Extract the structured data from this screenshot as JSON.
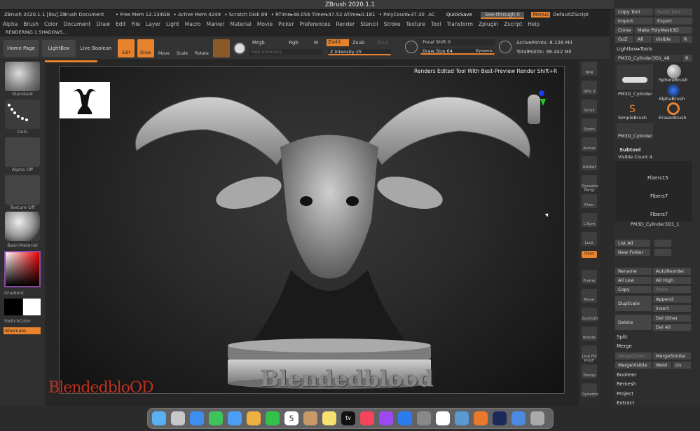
{
  "window": {
    "title": "ZBrush 2020.1.1"
  },
  "infobar": {
    "doc": "ZBrush 2020.1.1 [ibu] ZBrush Document",
    "free_mem": "• Free Mem 12.134GB",
    "active_mem": "• Active Mem 4249",
    "scratch": "• Scratch Disk 89",
    "rtime": "• RTime▸48.056 Timer▸47.52 ATime▸0.181",
    "polycount": "• PolyCount▸37.30",
    "ac": "AC",
    "quicksave": "QuickSave",
    "seethrough": "See-through 0",
    "menus": "Menus",
    "defaultzscript": "DefaultZScript"
  },
  "menubar": {
    "items": [
      "Alpha",
      "Brush",
      "Color",
      "Document",
      "Draw",
      "Edit",
      "File",
      "Layer",
      "Light",
      "Macro",
      "Marker",
      "Material",
      "Movie",
      "Picker",
      "Preferences",
      "Render",
      "Stencil",
      "Stroke",
      "Texture",
      "Tool",
      "Transform",
      "Zplugin",
      "Zscript",
      "Help"
    ]
  },
  "renderbar": {
    "label": "RENDERING 1  SHADOWS..."
  },
  "toolbar": {
    "home": "Home Page",
    "lightbox": "LightBox",
    "live_boolean": "Live Boolean",
    "edit": "Edit",
    "draw": "Draw",
    "move": "Move",
    "scale": "Scale",
    "rotate": "Rotate",
    "mrgb": "Mrgb",
    "rgb": "Rgb",
    "m": "M",
    "rgb_intensity": "Rgb Intensity",
    "zadd": "Zadd",
    "zsub": "Zsub",
    "zcut": "Zcut",
    "z_intensity": "Z Intensity 25",
    "focal_shift": "Focal Shift 0",
    "draw_size": "Draw Size 64",
    "dynamic": "Dynamic",
    "active_points": "ActivePoints: 8.126 Mil",
    "total_points": "TotalPoints: 38.442 Mil"
  },
  "leftpanel": {
    "standard": "Standard",
    "dots": "Dots",
    "alpha_off": "Alpha Off",
    "texture_off": "Texture Off",
    "material": "BasicMaterial",
    "gradient": "Gradient",
    "switchcolor": "SwitchColor",
    "alternate": "Alternate"
  },
  "canvas": {
    "tooltip": "Renders Edited Tool With Best-Preview Render  Shift+R",
    "plate_text": "Blendedblood",
    "watermark": "BlendedbloOD"
  },
  "rightshelf": {
    "items": [
      "BPR",
      "SPix 3",
      "Scroll",
      "Zoom",
      "Actual",
      "AAHalf",
      "Dynamic Persp",
      "Floor",
      "L.Sym",
      "Lock",
      "Qxyz",
      "Frame",
      "Move",
      "Zoom3D",
      "Rotate",
      "Line Fill PolyF",
      "Transp",
      "Dynamic"
    ]
  },
  "rightpanel": {
    "copy_tool": "Copy Tool",
    "paste_tool": "Paste Tool",
    "import": "Import",
    "export": "Export",
    "clone": "Clone",
    "make_polymesh": "Make PolyMesh3D",
    "goz": "GoZ",
    "all": "All",
    "visible": "Visible",
    "r": "R",
    "lightbox_tools": "Lightbox▸Tools",
    "tool_name": "PM3D_Cylinder3D1_48",
    "tool_count": "R",
    "tools": [
      "PM3D_Cylinder",
      "SphereBrush",
      "AlphaBrush",
      "SimpleBrush",
      "EraserBrush",
      "PM3D_Cylinder"
    ],
    "subtool": "Subtool",
    "visible_count": "Visible Count 4",
    "fibers": [
      "Fibers15",
      "Fibers7",
      "Fibers7"
    ],
    "pm3d": "PM3D_Cylinder3D1_1",
    "list_all": "List All",
    "new_folder": "New Folder",
    "rename": "Rename",
    "autoreorder": "AutoReorder",
    "all_low": "All Low",
    "all_high": "All High",
    "copy": "Copy",
    "paste": "Paste",
    "duplicate": "Duplicate",
    "append": "Append",
    "insert": "Insert",
    "delete": "Delete",
    "del_other": "Del Other",
    "del_all": "Del All",
    "split": "Split",
    "merge": "Merge",
    "merge_down": "MergeDown",
    "merge_similar": "MergeSimilar",
    "merge_visible": "MergeVisible",
    "weld": "Weld",
    "uv": "Uv",
    "boolean": "Boolean",
    "remesh": "Remesh",
    "project": "Project",
    "extract": "Extract"
  },
  "dock": {
    "icons": [
      "finder",
      "launchpad",
      "safari",
      "messages",
      "mail",
      "photos",
      "facetime",
      "calendar",
      "contacts",
      "notes",
      "tv",
      "music",
      "podcasts",
      "appstore",
      "settings",
      "zbrush",
      "preview",
      "blender",
      "photoshop",
      "downloads",
      "trash"
    ],
    "calendar_day": "5",
    "tv_label": "tv"
  },
  "colors": {
    "accent": "#e8822c",
    "panel": "#2e2e2e"
  }
}
